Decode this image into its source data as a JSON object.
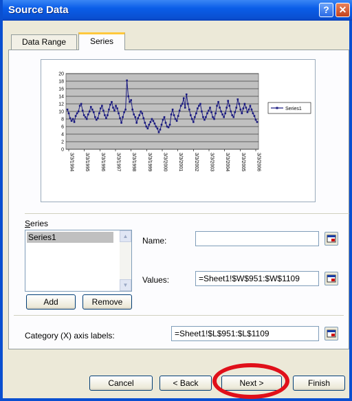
{
  "window": {
    "title": "Source Data",
    "help_glyph": "?",
    "close_glyph": "✕"
  },
  "tabs": [
    {
      "label": "Data Range",
      "active": false
    },
    {
      "label": "Series",
      "active": true
    }
  ],
  "chart_data": {
    "type": "line",
    "title": "",
    "ylim": [
      0,
      20
    ],
    "yticks": [
      "20",
      "18",
      "16",
      "14",
      "12",
      "10",
      "8",
      "6",
      "4",
      "2",
      "0"
    ],
    "xticks": [
      "3/3/1994",
      "3/3/1995",
      "3/3/1996",
      "3/3/1997",
      "3/3/1998",
      "3/3/1999",
      "3/3/2000",
      "3/3/2001",
      "3/3/2002",
      "3/3/2003",
      "3/3/2004",
      "3/3/2005",
      "3/3/2006"
    ],
    "grid": true,
    "legend_position": "right",
    "series": [
      {
        "name": "Series1",
        "color": "#1a1a80",
        "values": [
          10.5,
          9.5,
          8.2,
          7.5,
          8.0,
          7.2,
          8.8,
          9.5,
          10.0,
          11.5,
          12.0,
          10.2,
          9.0,
          8.5,
          8.0,
          9.2,
          10.0,
          11.2,
          10.5,
          9.8,
          8.5,
          7.8,
          8.2,
          9.5,
          10.8,
          11.5,
          10.2,
          9.0,
          8.2,
          9.0,
          10.5,
          11.8,
          12.5,
          11.0,
          10.2,
          11.5,
          10.8,
          9.5,
          8.2,
          7.0,
          8.5,
          9.8,
          10.5,
          18.2,
          14.0,
          12.5,
          13.0,
          10.5,
          9.2,
          8.5,
          7.0,
          8.2,
          9.0,
          10.0,
          9.5,
          8.2,
          7.0,
          6.0,
          5.5,
          6.5,
          7.2,
          8.0,
          7.5,
          6.8,
          6.0,
          5.5,
          4.5,
          5.2,
          6.5,
          7.8,
          8.5,
          7.0,
          6.0,
          5.8,
          6.5,
          9.2,
          10.5,
          9.0,
          8.0,
          7.5,
          8.8,
          10.2,
          11.5,
          12.0,
          13.5,
          11.0,
          14.5,
          12.0,
          10.5,
          9.0,
          8.0,
          7.2,
          8.5,
          9.5,
          10.8,
          11.5,
          12.0,
          10.0,
          8.5,
          7.8,
          8.5,
          9.5,
          10.2,
          11.0,
          9.8,
          8.5,
          8.0,
          9.5,
          11.5,
          12.5,
          11.0,
          10.0,
          9.2,
          8.5,
          9.5,
          11.0,
          12.8,
          11.5,
          10.0,
          9.0,
          8.5,
          9.8,
          11.0,
          13.2,
          12.0,
          10.5,
          9.5,
          10.8,
          12.0,
          11.0,
          9.8,
          10.5,
          11.5,
          10.5,
          9.5,
          8.8,
          7.8,
          7.2
        ]
      }
    ]
  },
  "series_section": {
    "group_label": "Series",
    "items": [
      "Series1"
    ],
    "add_label": "Add",
    "remove_label": "Remove",
    "name_label": "Name:",
    "name_value": "",
    "values_label": "Values:",
    "values_value": "=Sheet1!$W$951:$W$1109"
  },
  "category": {
    "label": "Category (X) axis labels:",
    "value": "=Sheet1!$L$951:$L$1109"
  },
  "buttons": {
    "cancel": "Cancel",
    "back": "< Back",
    "next": "Next >",
    "finish": "Finish"
  },
  "highlight_color": "#e0101a"
}
